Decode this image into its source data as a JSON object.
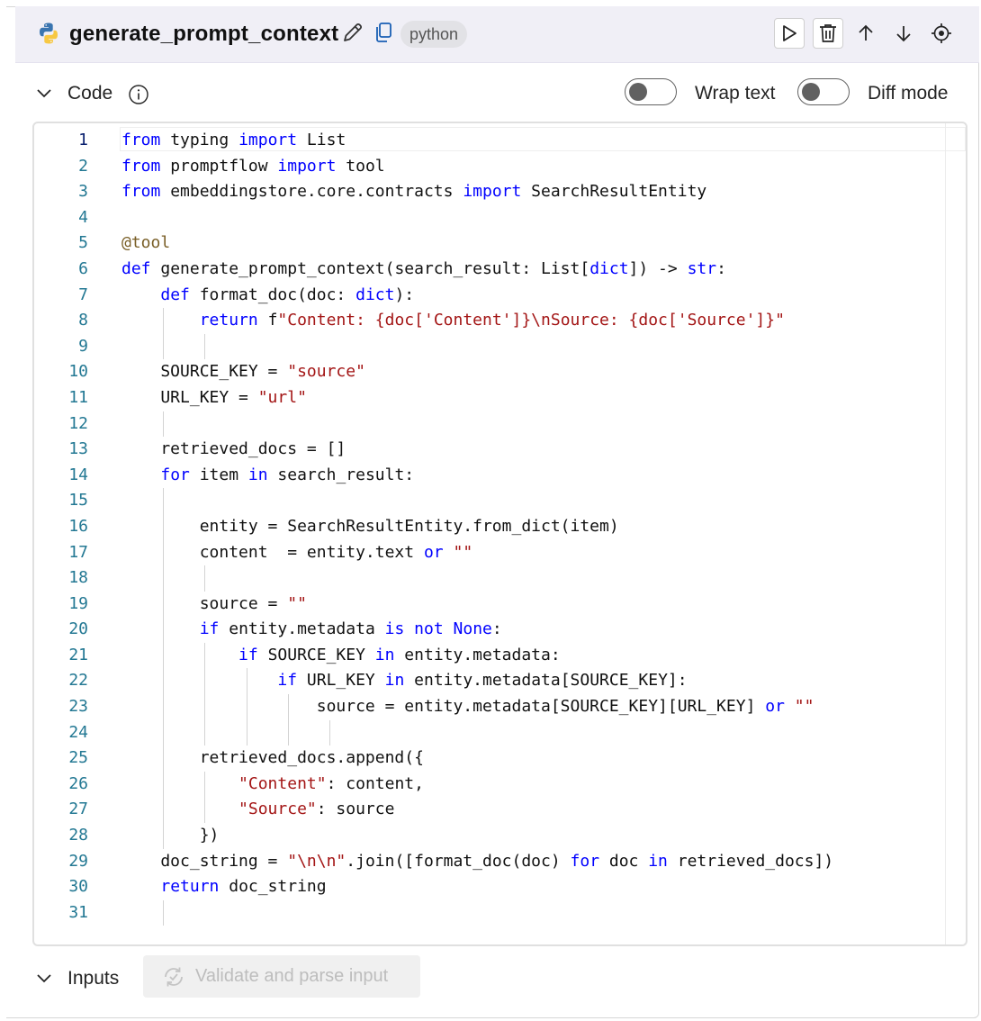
{
  "node": {
    "title": "generate_prompt_context",
    "language_badge": "python",
    "icons": [
      "python-icon",
      "edit-icon",
      "copy-icon",
      "run-icon",
      "delete-icon",
      "move-up-icon",
      "move-down-icon",
      "locate-icon"
    ]
  },
  "code_section": {
    "label": "Code",
    "wrap_text_label": "Wrap text",
    "wrap_text_on": false,
    "diff_mode_label": "Diff mode",
    "diff_mode_on": false
  },
  "inputs_section": {
    "label": "Inputs",
    "validate_button_label": "Validate and parse input",
    "validate_button_enabled": false
  },
  "code_lines": [
    "from typing import List",
    "from promptflow import tool",
    "from embeddingstore.core.contracts import SearchResultEntity",
    "",
    "@tool",
    "def generate_prompt_context(search_result: List[dict]) -> str:",
    "    def format_doc(doc: dict):",
    "        return f\"Content: {doc['Content']}\\nSource: {doc['Source']}\"",
    "",
    "    SOURCE_KEY = \"source\"",
    "    URL_KEY = \"url\"",
    "",
    "    retrieved_docs = []",
    "    for item in search_result:",
    "",
    "        entity = SearchResultEntity.from_dict(item)",
    "        content  = entity.text or \"\"",
    "",
    "        source = \"\"",
    "        if entity.metadata is not None:",
    "            if SOURCE_KEY in entity.metadata:",
    "                if URL_KEY in entity.metadata[SOURCE_KEY]:",
    "                    source = entity.metadata[SOURCE_KEY][URL_KEY] or \"\"",
    "",
    "        retrieved_docs.append({",
    "            \"Content\": content,",
    "            \"Source\": source",
    "        })",
    "    doc_string = \"\\n\\n\".join([format_doc(doc) for doc in retrieved_docs])",
    "    return doc_string",
    ""
  ],
  "active_line": 1
}
